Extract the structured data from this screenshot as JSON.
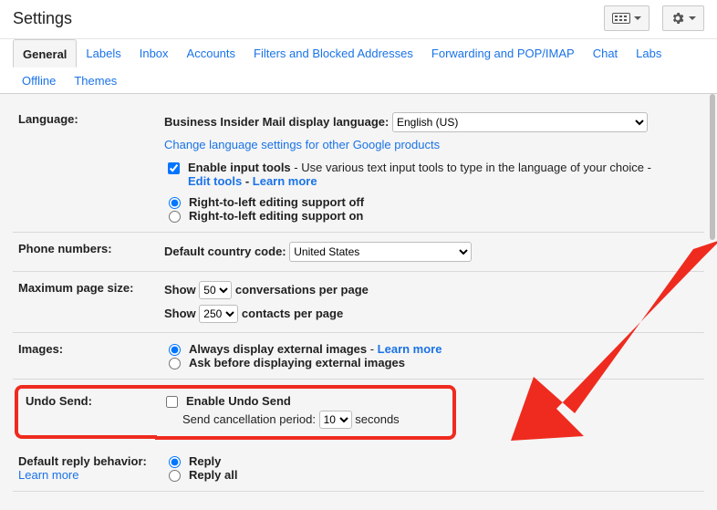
{
  "header": {
    "title": "Settings"
  },
  "tabs": {
    "general": "General",
    "labels": "Labels",
    "inbox": "Inbox",
    "accounts": "Accounts",
    "filters": "Filters and Blocked Addresses",
    "forwarding": "Forwarding and POP/IMAP",
    "chat": "Chat",
    "labs": "Labs",
    "offline": "Offline",
    "themes": "Themes"
  },
  "language": {
    "label": "Language:",
    "display_label": "Business Insider Mail display language:",
    "display_value": "English (US)",
    "change_link": "Change language settings for other Google products",
    "enable_input_tools_label": "Enable input tools",
    "enable_input_tools_desc": " - Use various text input tools to type in the language of your choice - ",
    "edit_tools": "Edit tools",
    "sep": " - ",
    "learn_more": "Learn more",
    "rtl_off": "Right-to-left editing support off",
    "rtl_on": "Right-to-left editing support on"
  },
  "phone": {
    "label": "Phone numbers:",
    "cc_label": "Default country code:",
    "cc_value": "United States"
  },
  "page_size": {
    "label": "Maximum page size:",
    "show1": "Show",
    "val1": "50",
    "after1": "conversations per page",
    "show2": "Show",
    "val2": "250",
    "after2": "contacts per page"
  },
  "images": {
    "label": "Images:",
    "always": "Always display external images",
    "learn_more": "Learn more",
    "dash": " - ",
    "ask": "Ask before displaying external images"
  },
  "undo": {
    "label": "Undo Send:",
    "enable": "Enable Undo Send",
    "period_label": "Send cancellation period:",
    "period_value": "10",
    "seconds": "seconds"
  },
  "reply": {
    "label": "Default reply behavior:",
    "learn_more": "Learn more",
    "reply": "Reply",
    "reply_all": "Reply all"
  }
}
